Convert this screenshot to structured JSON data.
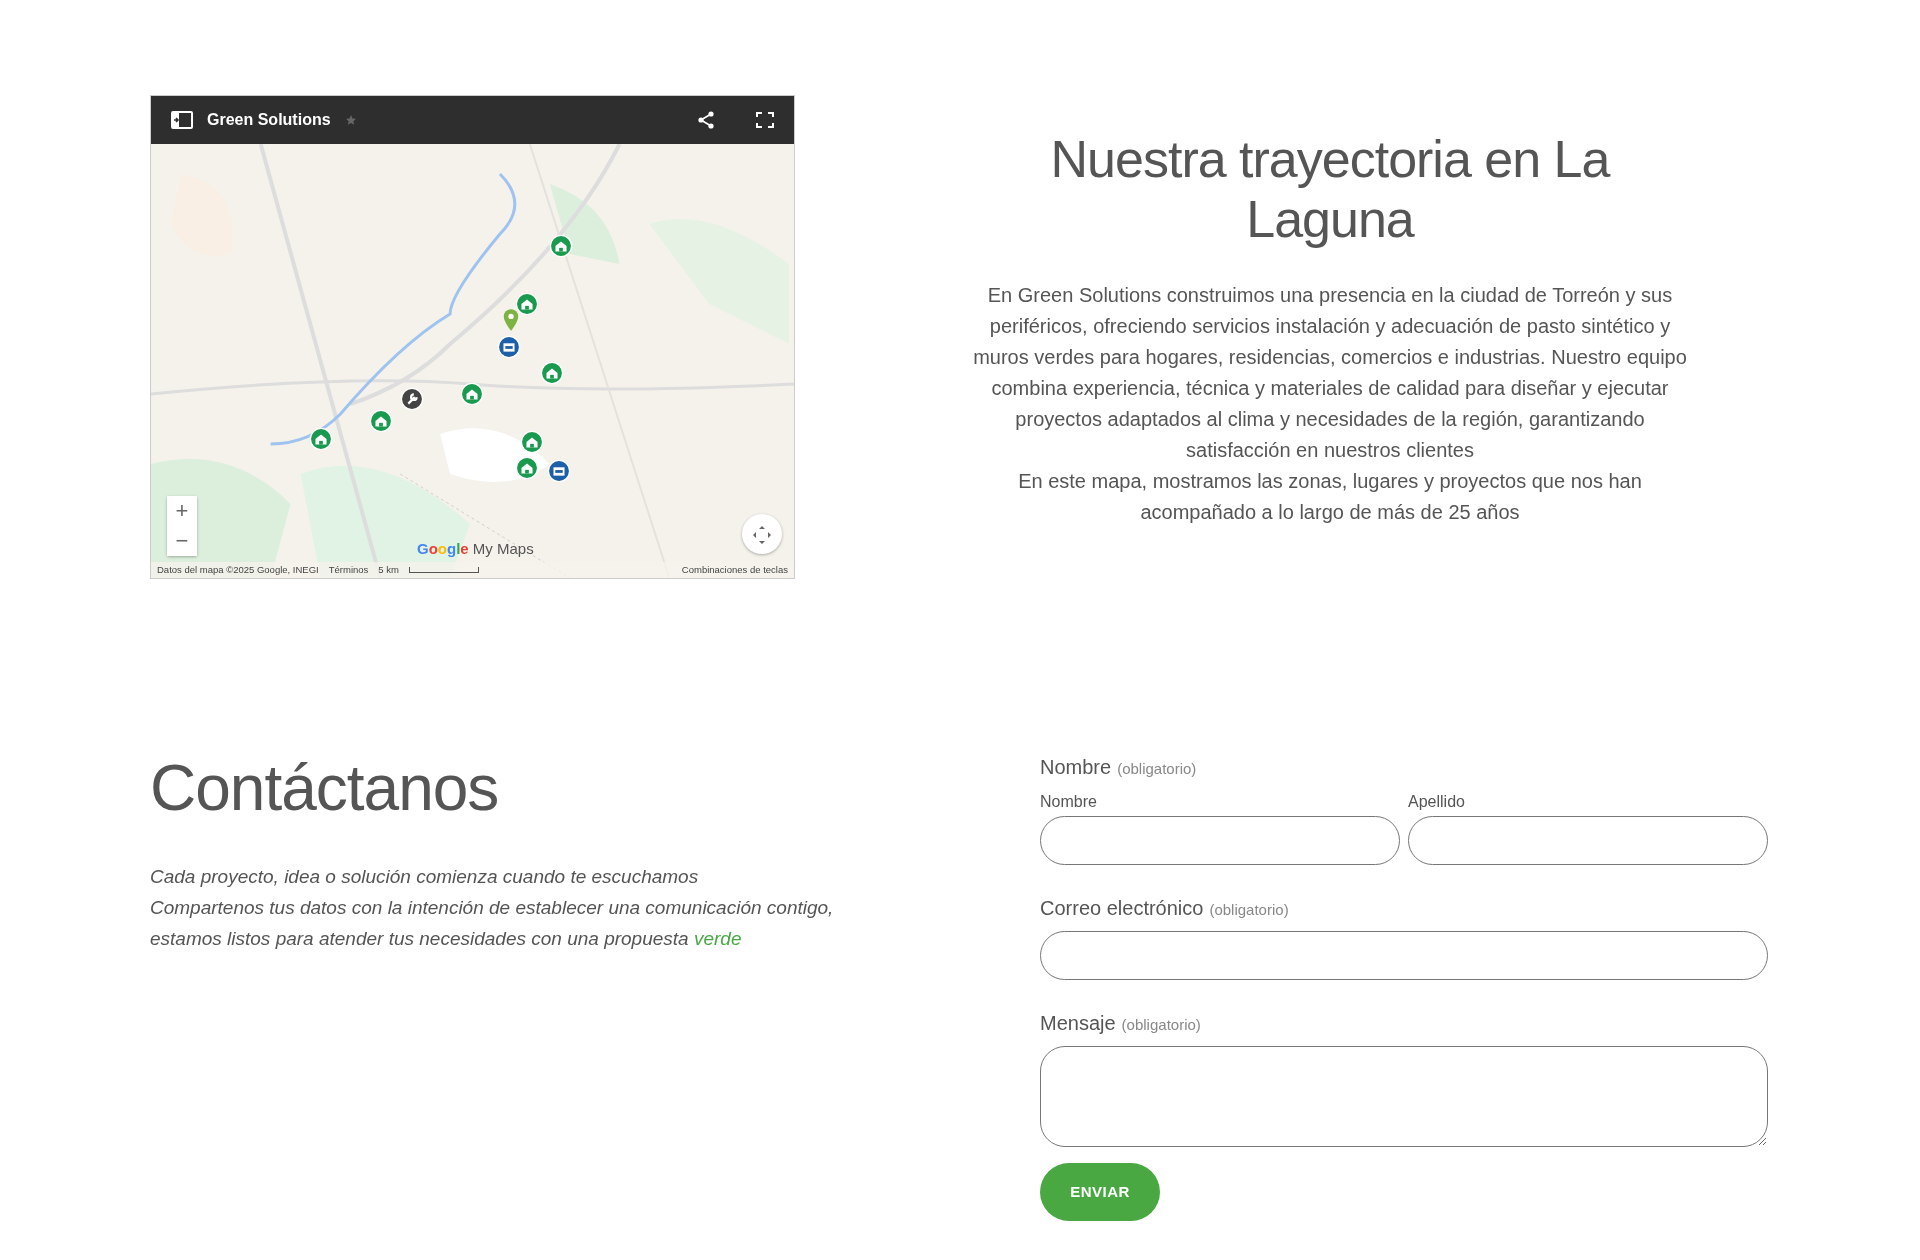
{
  "map": {
    "title": "Green Solutions",
    "zoom_in": "+",
    "zoom_out": "−",
    "logo": "Google",
    "logo_suffix": "My Maps",
    "attribution": "Datos del mapa ©2025 Google, INEGI",
    "terms": "Términos",
    "scale": "5 km",
    "shortcuts": "Combinaciones de teclas"
  },
  "about": {
    "title": "Nuestra trayectoria en La Laguna",
    "paragraphs": [
      "En Green Solutions construimos una presencia en la ciudad de Torreón y sus periféricos, ofreciendo servicios instalación y adecuación de pasto sintético y muros verdes para hogares, residencias, comercios e industrias. Nuestro equipo combina experiencia, técnica y materiales de calidad para diseñar y ejecutar proyectos adaptados al clima y necesidades de la región, garantizando satisfacción en nuestros clientes",
      "En este mapa, mostramos las zonas, lugares y proyectos que nos han acompañado a lo largo de más de 25 años"
    ]
  },
  "contact": {
    "title": "Contáctanos",
    "lines": [
      "Cada proyecto, idea o solución comienza cuando te escuchamos",
      "Compartenos tus datos con la intención de establecer una comunicación contigo,",
      "estamos listos para atender tus necesidades con una propuesta"
    ],
    "highlight": "verde"
  },
  "form": {
    "name": {
      "label": "Nombre",
      "required": "(obligatorio)",
      "fields": [
        {
          "label": "Nombre"
        },
        {
          "label": "Apellido"
        }
      ]
    },
    "email": {
      "label": "Correo electrónico",
      "required": "(obligatorio)"
    },
    "message": {
      "label": "Mensaje",
      "required": "(obligatorio)"
    },
    "submit": "ENVIAR"
  }
}
